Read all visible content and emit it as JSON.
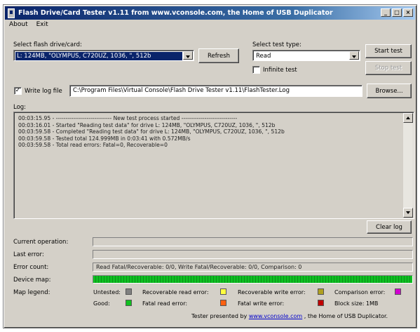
{
  "window": {
    "title": "Flash Drive/Card Tester v1.11 from www.vconsole.com, the Home of USB Duplicator",
    "controls": [
      "_",
      "□",
      "×"
    ]
  },
  "menu": [
    "About",
    "Exit"
  ],
  "drive": {
    "label": "Select flash drive/card:",
    "value": "L: 124MB, \"OLYMPUS, C720UZ, 1036, \", 512b",
    "refresh_label": "Refresh"
  },
  "test": {
    "label": "Select test type:",
    "value": "Read",
    "infinite_label": "Infinite test",
    "infinite_checked": false,
    "start_label": "Start test",
    "stop_label": "Stop test"
  },
  "logfile": {
    "checkbox_label": "Write log file",
    "checked": true,
    "path": "C:\\Program Files\\Virtual Console\\Flash Drive Tester v1.11\\FlashTester.Log",
    "browse_label": "Browse..."
  },
  "log": {
    "label": "Log:",
    "lines": [
      "00:03:15.95 - ----------------------------- New test process started -----------------------------",
      "00:03:16.01 - Started \"Reading test data\" for drive L: 124MB, \"OLYMPUS, C720UZ, 1036, \", 512b",
      "00:03:59.58 - Completed \"Reading test data\" for drive L: 124MB, \"OLYMPUS, C720UZ, 1036, \", 512b",
      "00:03:59.58 - Tested total 124.999MB in 0:03:41 with  0.572MB/s",
      "00:03:59.58 - Total read errors: Fatal=0, Recoverable=0"
    ],
    "clear_label": "Clear log"
  },
  "status": {
    "current_operation_label": "Current operation:",
    "current_operation": "",
    "last_error_label": "Last error:",
    "last_error": "",
    "error_count_label": "Error count:",
    "error_count": "Read Fatal/Recoverable: 0/0, Write Fatal/Recoverable: 0/0, Comparison: 0",
    "device_map_label": "Device map:"
  },
  "legend": {
    "label": "Map legend:",
    "untested": "Untested:",
    "good": "Good:",
    "recoverable_read": "Recoverable read error:",
    "fatal_read": "Fatal read error:",
    "recoverable_write": "Recoverable write error:",
    "fatal_write": "Fatal write error:",
    "comparison": "Comparison error:",
    "block_size": "Block size: 1MB",
    "colors": {
      "untested": "#808080",
      "good": "#10c020",
      "recoverable_read": "#ffff40",
      "fatal_read": "#ff6010",
      "recoverable_write": "#b0a020",
      "fatal_write": "#c00000",
      "comparison": "#d000d0"
    }
  },
  "footer": {
    "prefix": "Tester presented by",
    "link": "www.vconsole.com",
    "suffix": ", the Home of USB Duplicator."
  }
}
